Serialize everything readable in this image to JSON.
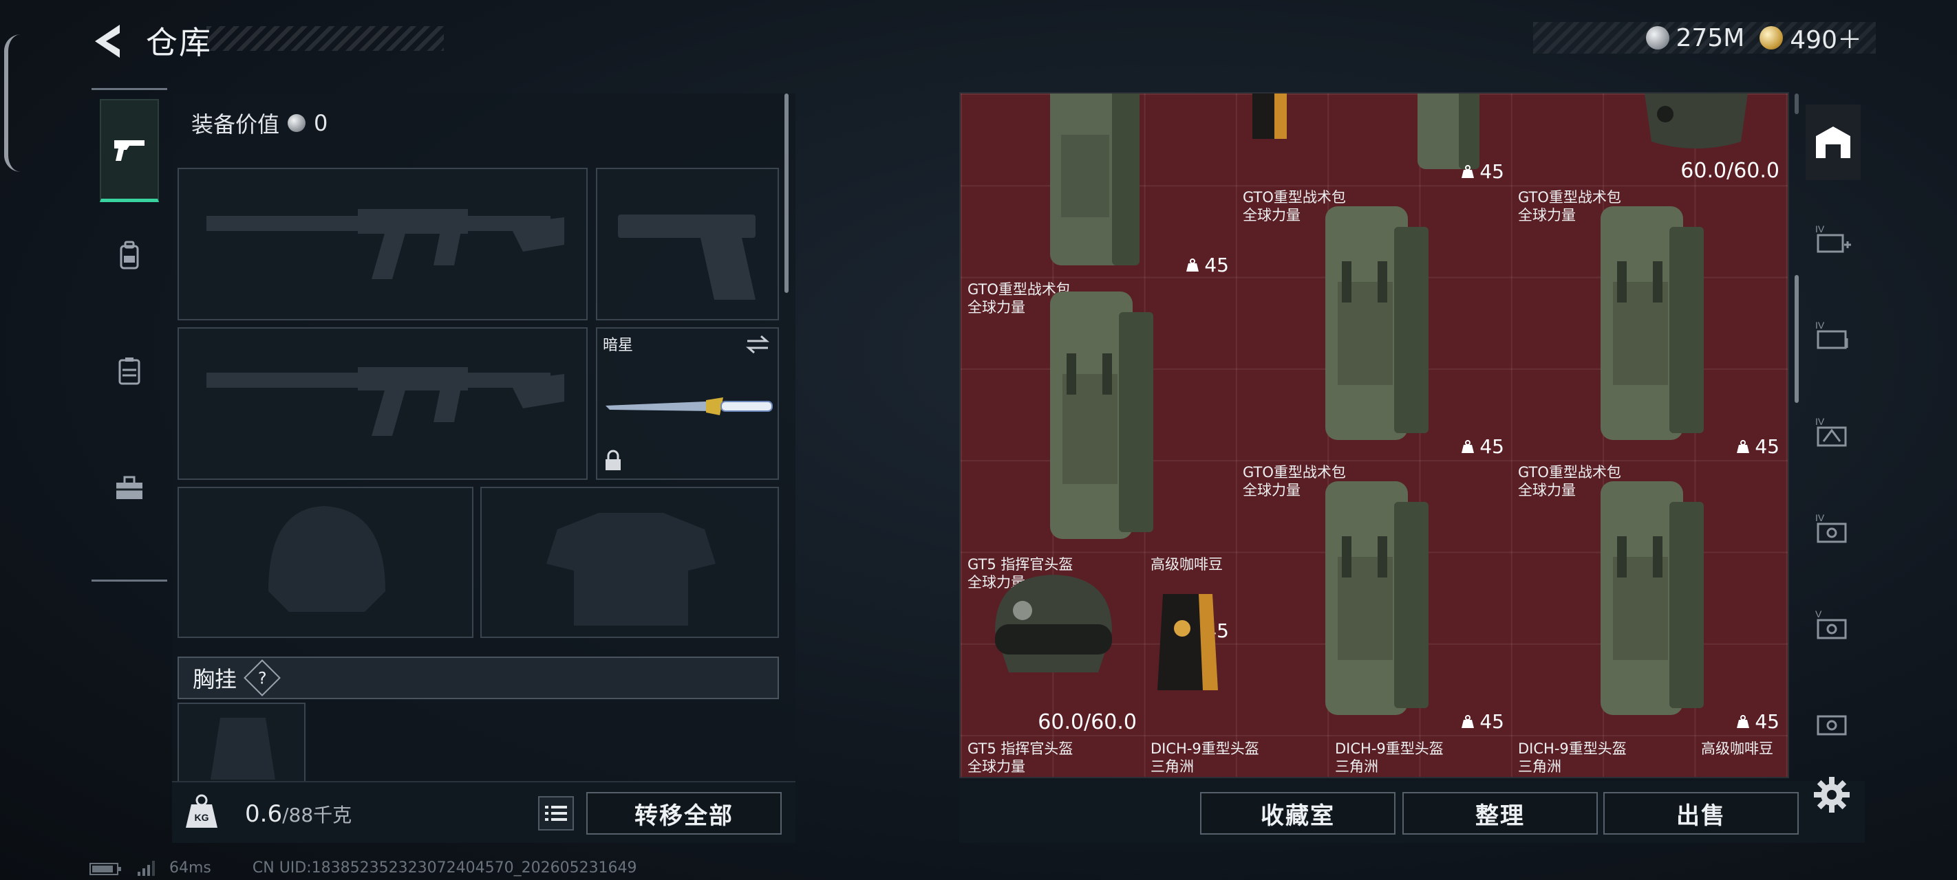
{
  "header": {
    "title": "仓库",
    "currencies": [
      {
        "icon": "silver-coin-icon",
        "value": "275M"
      },
      {
        "icon": "gold-coin-icon",
        "value": "490＋"
      }
    ]
  },
  "loadout": {
    "equip_value_label": "装备价值",
    "equip_value": "0",
    "knife_name": "暗星",
    "chest_label": "胸挂",
    "help": "?",
    "weight_current": "0.6",
    "weight_max": "/88千克",
    "transfer_all": "转移全部"
  },
  "storage": {
    "items": [
      {
        "name1": "GTO重型战术包",
        "name2": "全球力量",
        "count": "45"
      },
      {
        "name1": "GTO重型战术包",
        "name2": "全球力量",
        "count": "45"
      },
      {
        "name1": "GTO重型战术包",
        "name2": "全球力量",
        "count": "45"
      },
      {
        "name1": "GTO重型战术包",
        "name2": "全球力量",
        "count": "45"
      },
      {
        "name1": "GTO重型战术包",
        "name2": "全球力量",
        "count": "45"
      },
      {
        "name1": "GT5 指挥官头盔",
        "name2": "全球力量",
        "durability": "60.0/60.0"
      },
      {
        "name1": "高级咖啡豆"
      },
      {
        "name1": "GT5 指挥官头盔",
        "name2": "全球力量"
      },
      {
        "name1": "DICH-9重型头盔",
        "name2": "三角洲"
      },
      {
        "name1": "DICH-9重型头盔",
        "name2": "三角洲"
      },
      {
        "name1": "DICH-9重型头盔",
        "name2": "三角洲"
      },
      {
        "name1": "高级咖啡豆"
      }
    ],
    "top_partial": [
      {
        "count": "45"
      },
      {
        "count": "45"
      },
      {
        "durability": "60.0/60.0"
      }
    ]
  },
  "actions": {
    "collection": "收藏室",
    "organize": "整理",
    "sell": "出售"
  },
  "footer": {
    "ping": "64ms",
    "uid": "CN UID:18385235232307240457​0_202605231649"
  },
  "colors": {
    "accent_green": "#38d39f",
    "storage_bg": "#5a1f25"
  }
}
